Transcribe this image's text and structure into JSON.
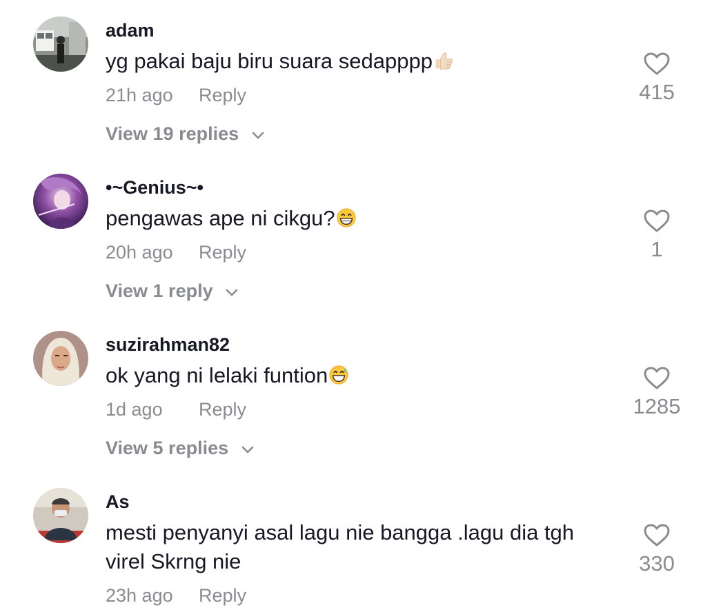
{
  "comments": [
    {
      "username": "adam",
      "text": "yg pakai baju biru suara sedapppp",
      "emoji": "thumbs-up-icon",
      "time": "21h ago",
      "reply_label": "Reply",
      "likes": "415",
      "view_replies": "View 19 replies"
    },
    {
      "username": "•~Genius~•",
      "text": "pengawas ape ni cikgu?",
      "emoji": "grinning-face-icon",
      "time": "20h ago",
      "reply_label": "Reply",
      "likes": "1",
      "view_replies": "View 1 reply"
    },
    {
      "username": "suzirahman82",
      "text": "ok yang ni lelaki funtion",
      "emoji": "grinning-sweat-face-icon",
      "time": "1d ago",
      "reply_label": "Reply",
      "likes": "1285",
      "view_replies": "View 5 replies"
    },
    {
      "username": "As",
      "text": "mesti penyanyi asal lagu nie bangga .lagu dia tgh virel Skrng nie",
      "time": "23h ago",
      "reply_label": "Reply",
      "likes": "330"
    }
  ],
  "colors": {
    "text": "#161823",
    "secondary": "#8a8b91"
  }
}
